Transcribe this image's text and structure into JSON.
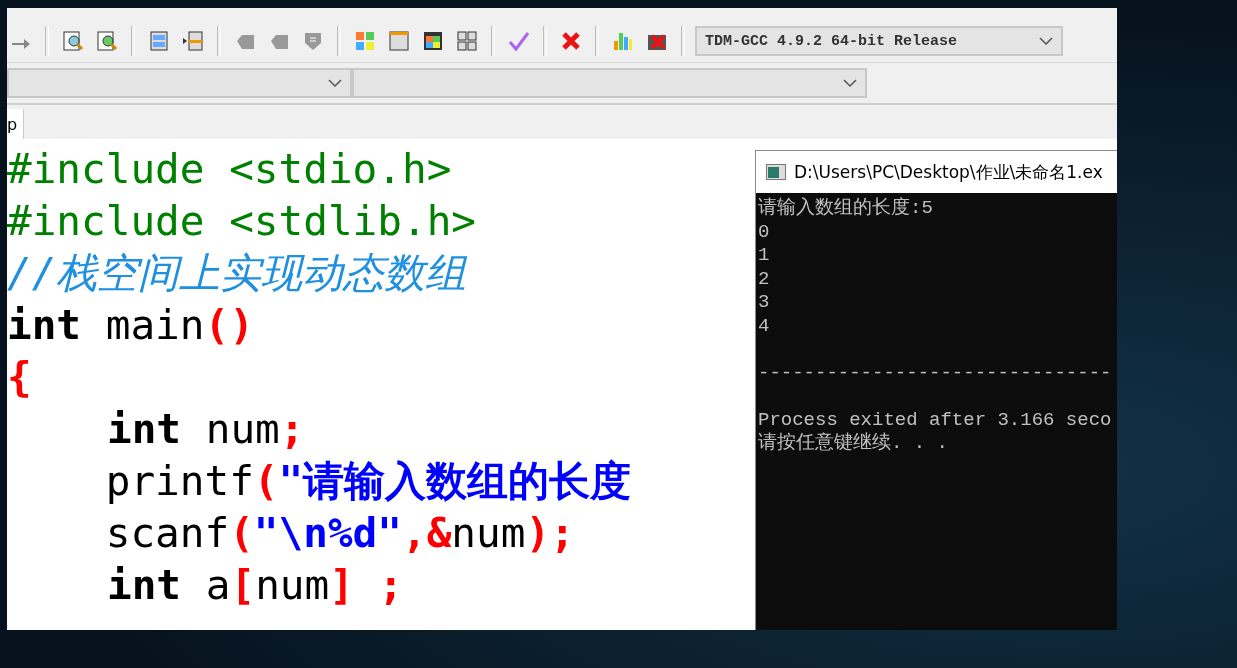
{
  "compiler_select": {
    "value": "TDM-GCC 4.9.2 64-bit Release"
  },
  "tabs": [
    {
      "label": "p",
      "selected": true
    }
  ],
  "code_lines": [
    [
      {
        "kind": "preprocessor",
        "text": "#include <stdio.h>"
      }
    ],
    [
      {
        "kind": "preprocessor",
        "text": "#include <stdlib.h>"
      }
    ],
    [
      {
        "kind": "comment",
        "text": "//栈空间上实现动态数组"
      }
    ],
    [
      {
        "kind": "keyword",
        "text": "int"
      },
      {
        "kind": "plain",
        "text": " main"
      },
      {
        "kind": "symbol",
        "text": "()"
      }
    ],
    [
      {
        "kind": "symbol",
        "text": "{"
      }
    ],
    [
      {
        "kind": "indent"
      },
      {
        "kind": "keyword",
        "text": "int"
      },
      {
        "kind": "plain",
        "text": " num"
      },
      {
        "kind": "symbol",
        "text": ";"
      }
    ],
    [
      {
        "kind": "plain",
        "text": "    printf"
      },
      {
        "kind": "symbol",
        "text": "("
      },
      {
        "kind": "string",
        "text": "\"请输入数组的长度"
      }
    ],
    [
      {
        "kind": "plain",
        "text": "    scanf"
      },
      {
        "kind": "symbol",
        "text": "("
      },
      {
        "kind": "string",
        "text": "\"\\n%d\""
      },
      {
        "kind": "symbol",
        "text": ",&"
      },
      {
        "kind": "plain",
        "text": "num"
      },
      {
        "kind": "symbol",
        "text": ");"
      }
    ],
    [
      {
        "kind": "indent"
      },
      {
        "kind": "keyword",
        "text": "int"
      },
      {
        "kind": "plain",
        "text": " a"
      },
      {
        "kind": "symbol",
        "text": "["
      },
      {
        "kind": "plain",
        "text": "num"
      },
      {
        "kind": "symbol",
        "text": "] ;"
      }
    ]
  ],
  "console": {
    "title": "D:\\Users\\PC\\Desktop\\作业\\未命名1.ex",
    "lines": [
      "请输入数组的长度:5",
      "0",
      "1",
      "2",
      "3",
      "4"
    ],
    "separator": "-------------------------------",
    "footer": [
      "Process exited after 3.166 seco",
      "请按任意键继续. . ."
    ]
  }
}
